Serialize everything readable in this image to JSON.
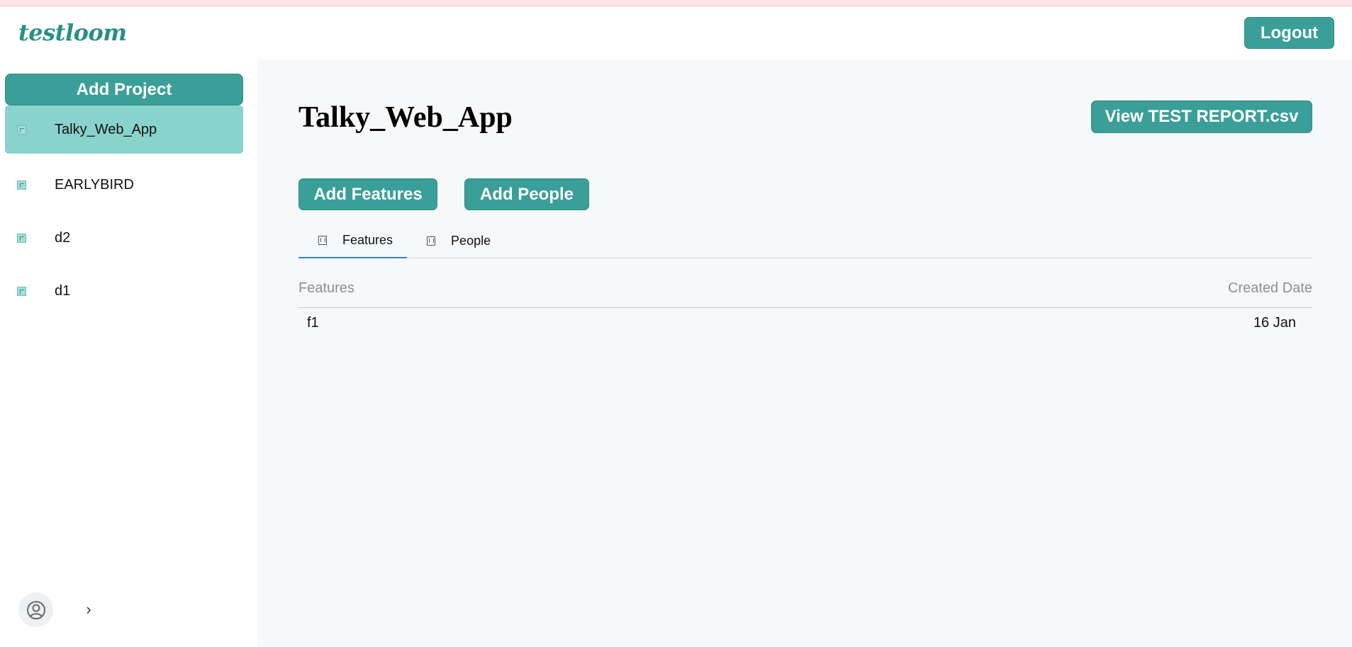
{
  "header": {
    "logo": "testloom",
    "logout_label": "Logout"
  },
  "sidebar": {
    "add_project_label": "Add Project",
    "projects": [
      {
        "label": "Talky_Web_App",
        "active": true
      },
      {
        "label": "EARLYBIRD",
        "active": false
      },
      {
        "label": "d2",
        "active": false
      },
      {
        "label": "d1",
        "active": false
      }
    ],
    "expand_icon": "›"
  },
  "main": {
    "title": "Talky_Web_App",
    "view_report_label": "View TEST REPORT.csv",
    "add_features_label": "Add Features",
    "add_people_label": "Add People",
    "tabs": [
      {
        "label": "Features",
        "active": true
      },
      {
        "label": "People",
        "active": false
      }
    ],
    "table": {
      "columns": [
        "Features",
        "Created Date"
      ],
      "rows": [
        {
          "feature": "f1",
          "created": "16 Jan"
        }
      ]
    }
  },
  "colors": {
    "accent": "#3a9f98",
    "active_project_bg": "#88d3cc",
    "content_bg": "#f7f8fa",
    "tab_underline": "#3b7fd4",
    "top_strip": "#fde4e8"
  }
}
